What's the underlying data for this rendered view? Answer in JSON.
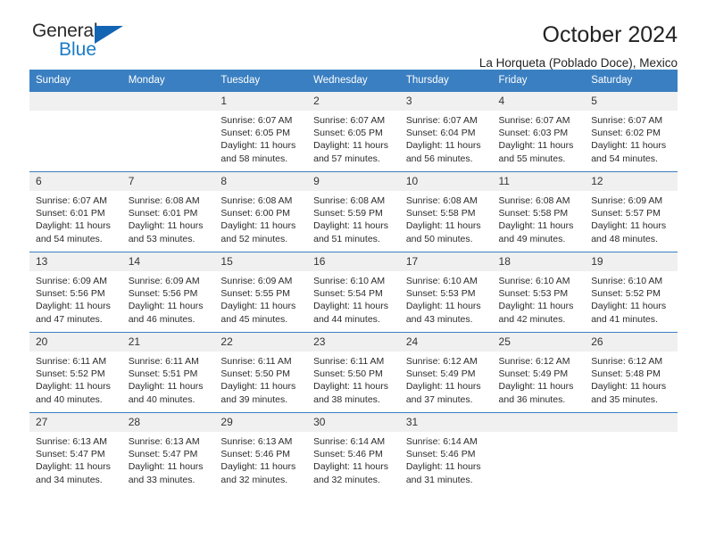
{
  "brand": {
    "name_part1": "General",
    "name_part2": "Blue",
    "triangle_color": "#1464b4",
    "blue_color": "#1a7cc8"
  },
  "header": {
    "title": "October 2024",
    "subtitle": "La Horqueta (Poblado Doce), Mexico"
  },
  "theme": {
    "header_bar": "#3a7fc1",
    "daynum_band": "#f0f0f0",
    "text": "#2b2b2b"
  },
  "weekday_headers": [
    "Sunday",
    "Monday",
    "Tuesday",
    "Wednesday",
    "Thursday",
    "Friday",
    "Saturday"
  ],
  "labels": {
    "sunrise_prefix": "Sunrise:",
    "sunset_prefix": "Sunset:",
    "daylight_prefix": "Daylight:"
  },
  "weeks": [
    [
      {
        "day": "",
        "blank": true
      },
      {
        "day": "",
        "blank": true
      },
      {
        "day": "1",
        "sunrise": "Sunrise: 6:07 AM",
        "sunset": "Sunset: 6:05 PM",
        "daylight1": "Daylight: 11 hours",
        "daylight2": "and 58 minutes."
      },
      {
        "day": "2",
        "sunrise": "Sunrise: 6:07 AM",
        "sunset": "Sunset: 6:05 PM",
        "daylight1": "Daylight: 11 hours",
        "daylight2": "and 57 minutes."
      },
      {
        "day": "3",
        "sunrise": "Sunrise: 6:07 AM",
        "sunset": "Sunset: 6:04 PM",
        "daylight1": "Daylight: 11 hours",
        "daylight2": "and 56 minutes."
      },
      {
        "day": "4",
        "sunrise": "Sunrise: 6:07 AM",
        "sunset": "Sunset: 6:03 PM",
        "daylight1": "Daylight: 11 hours",
        "daylight2": "and 55 minutes."
      },
      {
        "day": "5",
        "sunrise": "Sunrise: 6:07 AM",
        "sunset": "Sunset: 6:02 PM",
        "daylight1": "Daylight: 11 hours",
        "daylight2": "and 54 minutes."
      }
    ],
    [
      {
        "day": "6",
        "sunrise": "Sunrise: 6:07 AM",
        "sunset": "Sunset: 6:01 PM",
        "daylight1": "Daylight: 11 hours",
        "daylight2": "and 54 minutes."
      },
      {
        "day": "7",
        "sunrise": "Sunrise: 6:08 AM",
        "sunset": "Sunset: 6:01 PM",
        "daylight1": "Daylight: 11 hours",
        "daylight2": "and 53 minutes."
      },
      {
        "day": "8",
        "sunrise": "Sunrise: 6:08 AM",
        "sunset": "Sunset: 6:00 PM",
        "daylight1": "Daylight: 11 hours",
        "daylight2": "and 52 minutes."
      },
      {
        "day": "9",
        "sunrise": "Sunrise: 6:08 AM",
        "sunset": "Sunset: 5:59 PM",
        "daylight1": "Daylight: 11 hours",
        "daylight2": "and 51 minutes."
      },
      {
        "day": "10",
        "sunrise": "Sunrise: 6:08 AM",
        "sunset": "Sunset: 5:58 PM",
        "daylight1": "Daylight: 11 hours",
        "daylight2": "and 50 minutes."
      },
      {
        "day": "11",
        "sunrise": "Sunrise: 6:08 AM",
        "sunset": "Sunset: 5:58 PM",
        "daylight1": "Daylight: 11 hours",
        "daylight2": "and 49 minutes."
      },
      {
        "day": "12",
        "sunrise": "Sunrise: 6:09 AM",
        "sunset": "Sunset: 5:57 PM",
        "daylight1": "Daylight: 11 hours",
        "daylight2": "and 48 minutes."
      }
    ],
    [
      {
        "day": "13",
        "sunrise": "Sunrise: 6:09 AM",
        "sunset": "Sunset: 5:56 PM",
        "daylight1": "Daylight: 11 hours",
        "daylight2": "and 47 minutes."
      },
      {
        "day": "14",
        "sunrise": "Sunrise: 6:09 AM",
        "sunset": "Sunset: 5:56 PM",
        "daylight1": "Daylight: 11 hours",
        "daylight2": "and 46 minutes."
      },
      {
        "day": "15",
        "sunrise": "Sunrise: 6:09 AM",
        "sunset": "Sunset: 5:55 PM",
        "daylight1": "Daylight: 11 hours",
        "daylight2": "and 45 minutes."
      },
      {
        "day": "16",
        "sunrise": "Sunrise: 6:10 AM",
        "sunset": "Sunset: 5:54 PM",
        "daylight1": "Daylight: 11 hours",
        "daylight2": "and 44 minutes."
      },
      {
        "day": "17",
        "sunrise": "Sunrise: 6:10 AM",
        "sunset": "Sunset: 5:53 PM",
        "daylight1": "Daylight: 11 hours",
        "daylight2": "and 43 minutes."
      },
      {
        "day": "18",
        "sunrise": "Sunrise: 6:10 AM",
        "sunset": "Sunset: 5:53 PM",
        "daylight1": "Daylight: 11 hours",
        "daylight2": "and 42 minutes."
      },
      {
        "day": "19",
        "sunrise": "Sunrise: 6:10 AM",
        "sunset": "Sunset: 5:52 PM",
        "daylight1": "Daylight: 11 hours",
        "daylight2": "and 41 minutes."
      }
    ],
    [
      {
        "day": "20",
        "sunrise": "Sunrise: 6:11 AM",
        "sunset": "Sunset: 5:52 PM",
        "daylight1": "Daylight: 11 hours",
        "daylight2": "and 40 minutes."
      },
      {
        "day": "21",
        "sunrise": "Sunrise: 6:11 AM",
        "sunset": "Sunset: 5:51 PM",
        "daylight1": "Daylight: 11 hours",
        "daylight2": "and 40 minutes."
      },
      {
        "day": "22",
        "sunrise": "Sunrise: 6:11 AM",
        "sunset": "Sunset: 5:50 PM",
        "daylight1": "Daylight: 11 hours",
        "daylight2": "and 39 minutes."
      },
      {
        "day": "23",
        "sunrise": "Sunrise: 6:11 AM",
        "sunset": "Sunset: 5:50 PM",
        "daylight1": "Daylight: 11 hours",
        "daylight2": "and 38 minutes."
      },
      {
        "day": "24",
        "sunrise": "Sunrise: 6:12 AM",
        "sunset": "Sunset: 5:49 PM",
        "daylight1": "Daylight: 11 hours",
        "daylight2": "and 37 minutes."
      },
      {
        "day": "25",
        "sunrise": "Sunrise: 6:12 AM",
        "sunset": "Sunset: 5:49 PM",
        "daylight1": "Daylight: 11 hours",
        "daylight2": "and 36 minutes."
      },
      {
        "day": "26",
        "sunrise": "Sunrise: 6:12 AM",
        "sunset": "Sunset: 5:48 PM",
        "daylight1": "Daylight: 11 hours",
        "daylight2": "and 35 minutes."
      }
    ],
    [
      {
        "day": "27",
        "sunrise": "Sunrise: 6:13 AM",
        "sunset": "Sunset: 5:47 PM",
        "daylight1": "Daylight: 11 hours",
        "daylight2": "and 34 minutes."
      },
      {
        "day": "28",
        "sunrise": "Sunrise: 6:13 AM",
        "sunset": "Sunset: 5:47 PM",
        "daylight1": "Daylight: 11 hours",
        "daylight2": "and 33 minutes."
      },
      {
        "day": "29",
        "sunrise": "Sunrise: 6:13 AM",
        "sunset": "Sunset: 5:46 PM",
        "daylight1": "Daylight: 11 hours",
        "daylight2": "and 32 minutes."
      },
      {
        "day": "30",
        "sunrise": "Sunrise: 6:14 AM",
        "sunset": "Sunset: 5:46 PM",
        "daylight1": "Daylight: 11 hours",
        "daylight2": "and 32 minutes."
      },
      {
        "day": "31",
        "sunrise": "Sunrise: 6:14 AM",
        "sunset": "Sunset: 5:46 PM",
        "daylight1": "Daylight: 11 hours",
        "daylight2": "and 31 minutes."
      },
      {
        "day": "",
        "blank": true
      },
      {
        "day": "",
        "blank": true
      }
    ]
  ]
}
